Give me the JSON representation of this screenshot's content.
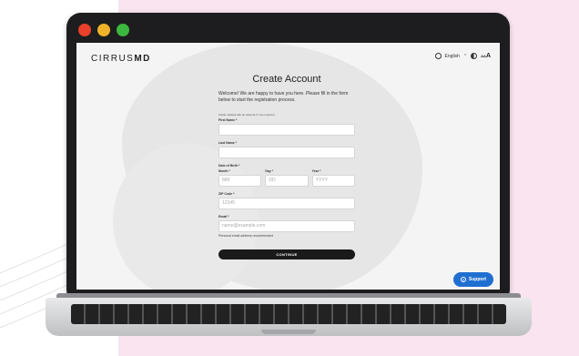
{
  "colors": {
    "traffic_red": "#e8402a",
    "traffic_yellow": "#f1b22a",
    "traffic_green": "#3db83e",
    "support_blue": "#1f6fd0"
  },
  "brand": {
    "logo_light": "CIRRUS",
    "logo_bold": "MD"
  },
  "header": {
    "language": "English",
    "language_caret": "⌃",
    "text_size_small": "A",
    "text_size_large": "A"
  },
  "form": {
    "title": "Create Account",
    "welcome": "Welcome! We are happy to have you here. Please fill in the form below to start the registration process.",
    "required_note": "Fields marked with an asterisk (*) are required",
    "first_name_label": "First Name *",
    "first_name_value": "",
    "last_name_label": "Last Name *",
    "last_name_value": "",
    "dob_label": "Date of Birth *",
    "month_label": "Month *",
    "month_placeholder": "MM",
    "day_label": "Day *",
    "day_placeholder": "DD",
    "year_label": "Year *",
    "year_placeholder": "YYYY",
    "zip_label": "ZIP Code *",
    "zip_placeholder": "12345",
    "email_label": "Email *",
    "email_placeholder": "name@example.com",
    "email_hint": "Personal email address recommended",
    "continue_label": "CONTINUE"
  },
  "support": {
    "label": "Support",
    "icon": "?"
  }
}
